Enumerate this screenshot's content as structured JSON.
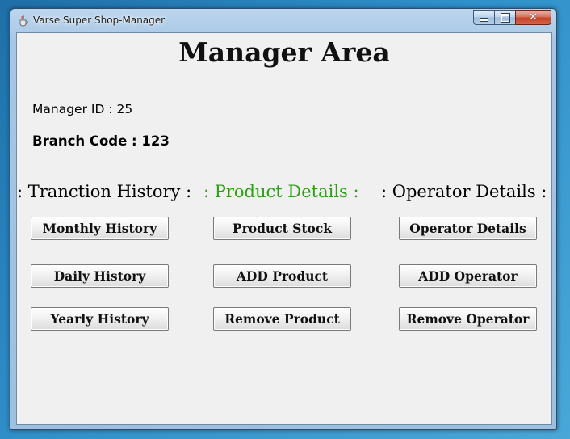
{
  "window": {
    "title": "Varse Super Shop-Manager"
  },
  "main": {
    "heading": "Manager Area",
    "manager_id_label": "Manager ID : 25",
    "branch_code_label": "Branch Code : 123"
  },
  "sections": {
    "transaction": {
      "title": ": Tranction History :",
      "buttons": [
        "Monthly History",
        "Daily History",
        "Yearly History"
      ]
    },
    "product": {
      "title": ": Product Details :",
      "color": "#2c9f16",
      "buttons": [
        "Product Stock",
        "ADD Product",
        "Remove Product"
      ]
    },
    "operator": {
      "title": ": Operator Details :",
      "buttons": [
        "Operator Details",
        "ADD Operator",
        "Remove Operator"
      ]
    }
  }
}
